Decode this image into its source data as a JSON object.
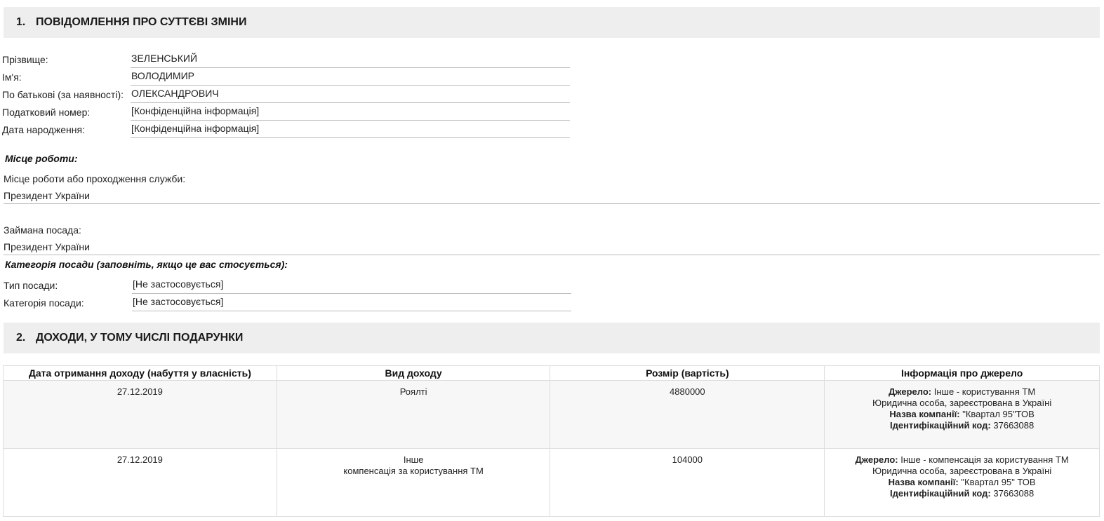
{
  "section1": {
    "number": "1.",
    "title": "ПОВІДОМЛЕННЯ ПРО СУТТЄВІ ЗМІНИ"
  },
  "person": {
    "surname_label": "Прізвище:",
    "surname": "ЗЕЛЕНСЬКИЙ",
    "name_label": "Ім'я:",
    "name": "ВОЛОДИМИР",
    "patronymic_label": "По батькові (за наявності):",
    "patronymic": "ОЛЕКСАНДРОВИЧ",
    "tax_label": "Податковий номер:",
    "tax": "[Конфіденційна інформація]",
    "birth_label": "Дата народження:",
    "birth": "[Конфіденційна інформація]"
  },
  "work": {
    "heading": "Місце роботи:",
    "place_label": "Місце роботи або проходження служби:",
    "place": "Президент України",
    "position_label": "Займана посада:",
    "position": "Президент України"
  },
  "category": {
    "heading": "Категорія посади (заповніть, якщо це вас стосується):",
    "type_label": "Тип посади:",
    "type": "[Не застосовується]",
    "cat_label": "Категорія посади:",
    "cat": "[Не застосовується]"
  },
  "section2": {
    "number": "2.",
    "title": "ДОХОДИ, У ТОМУ ЧИСЛІ ПОДАРУНКИ"
  },
  "income_table": {
    "headers": [
      "Дата отримання доходу (набуття у власність)",
      "Вид доходу",
      "Розмір (вартість)",
      "Інформація про джерело"
    ],
    "rows": [
      {
        "date": "27.12.2019",
        "type_line1": "Роялті",
        "type_line2": "",
        "amount": "4880000",
        "source_label": "Джерело:",
        "source": "Інше - користування ТМ",
        "entity": "Юридична особа, зареєстрована в Україні",
        "company_label": "Назва компанії:",
        "company": "\"Квартал 95\"ТОВ",
        "code_label": "Ідентифікаційний код:",
        "code": "37663088"
      },
      {
        "date": "27.12.2019",
        "type_line1": "Інше",
        "type_line2": "компенсація за користування ТМ",
        "amount": "104000",
        "source_label": "Джерело:",
        "source": "Інше - компенсація за користування ТМ",
        "entity": "Юридична особа, зареєстрована в Україні",
        "company_label": "Назва компанії:",
        "company": "\"Квартал 95\" ТОВ",
        "code_label": "Ідентифікаційний код:",
        "code": "37663088"
      }
    ]
  }
}
